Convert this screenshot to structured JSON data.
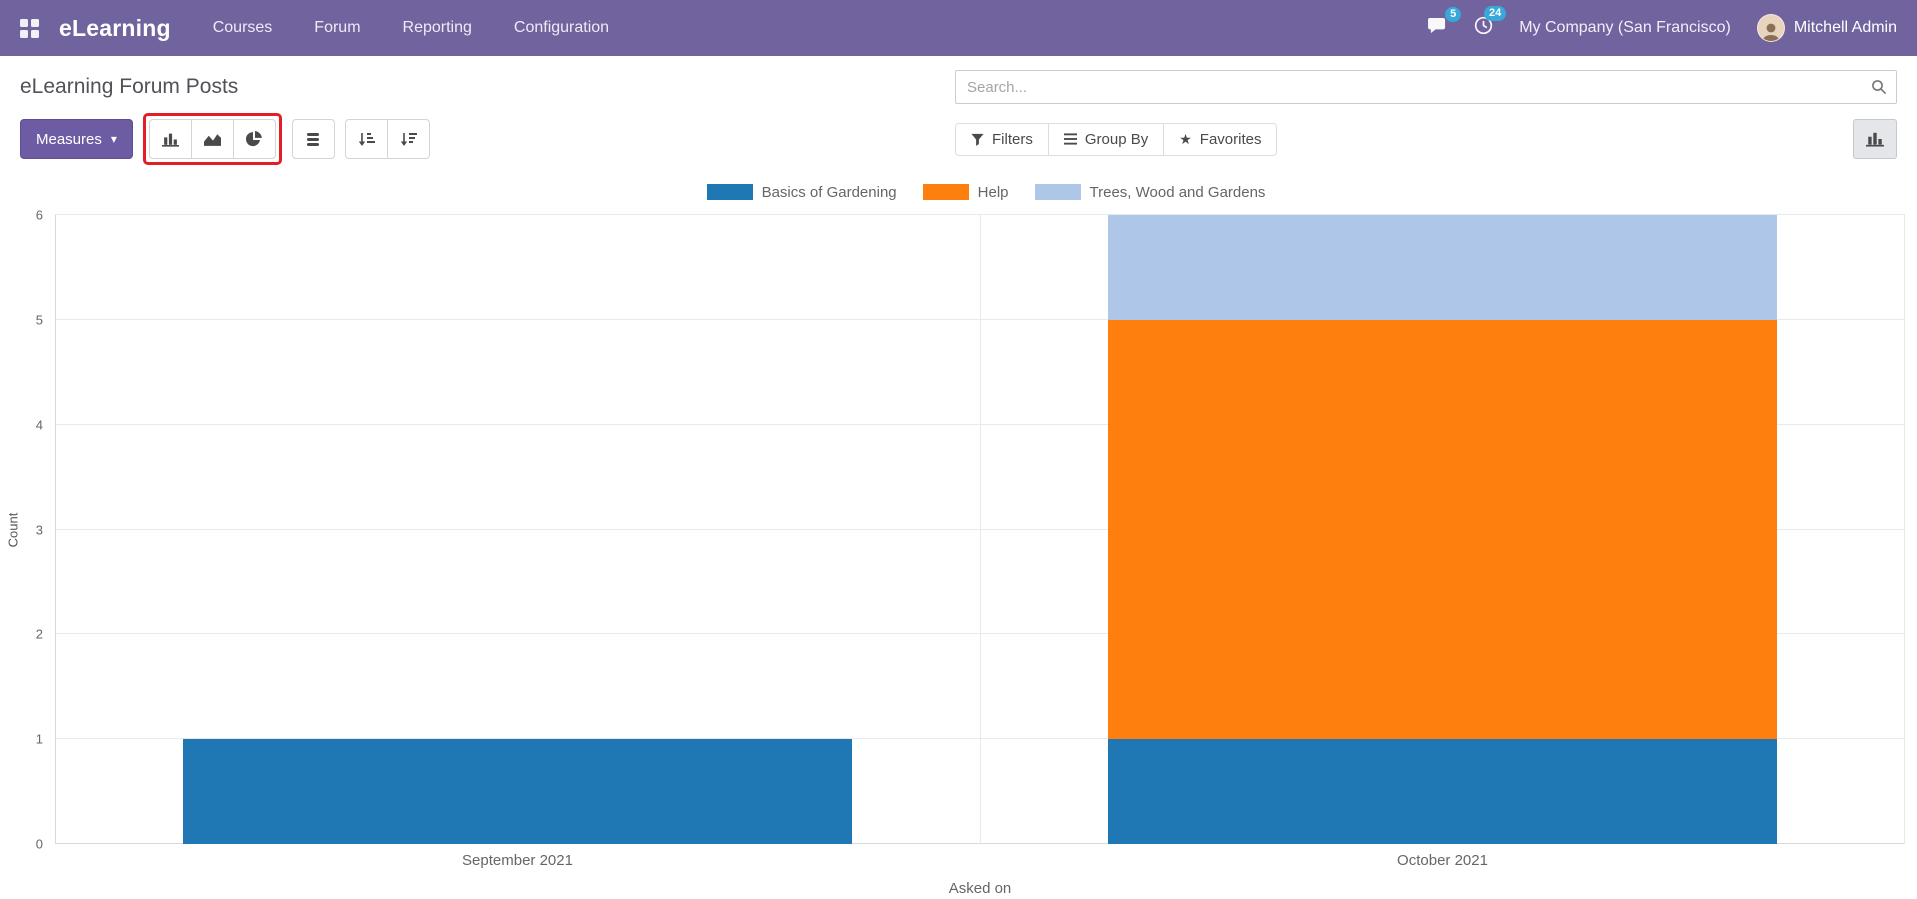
{
  "navbar": {
    "brand": "eLearning",
    "menus": [
      {
        "label": "Courses"
      },
      {
        "label": "Forum"
      },
      {
        "label": "Reporting"
      },
      {
        "label": "Configuration"
      }
    ],
    "messages_badge": "5",
    "activities_badge": "24",
    "company": "My Company (San Francisco)",
    "user": "Mitchell Admin"
  },
  "control_panel": {
    "title": "eLearning Forum Posts",
    "search_placeholder": "Search...",
    "measures_label": "Measures",
    "filters_label": "Filters",
    "group_by_label": "Group By",
    "favorites_label": "Favorites"
  },
  "chart_data": {
    "type": "bar",
    "stacked": true,
    "categories": [
      "September 2021",
      "October 2021"
    ],
    "series": [
      {
        "name": "Basics of Gardening",
        "color": "#1f77b4",
        "values": [
          1,
          1
        ]
      },
      {
        "name": "Help",
        "color": "#ff7f0e",
        "values": [
          0,
          4
        ]
      },
      {
        "name": "Trees, Wood and Gardens",
        "color": "#aec7e8",
        "values": [
          0,
          1
        ]
      }
    ],
    "title": "",
    "xlabel": "Asked on",
    "ylabel": "Count",
    "ylim": [
      0,
      6
    ],
    "yticks": [
      0,
      1,
      2,
      3,
      4,
      5,
      6
    ],
    "legend_position": "top",
    "grid": true
  },
  "colors": {
    "navbar_bg": "#71639e",
    "primary_button": "#6d5ba3",
    "badge": "#37a8d8",
    "annotation_red": "#e31e24"
  }
}
